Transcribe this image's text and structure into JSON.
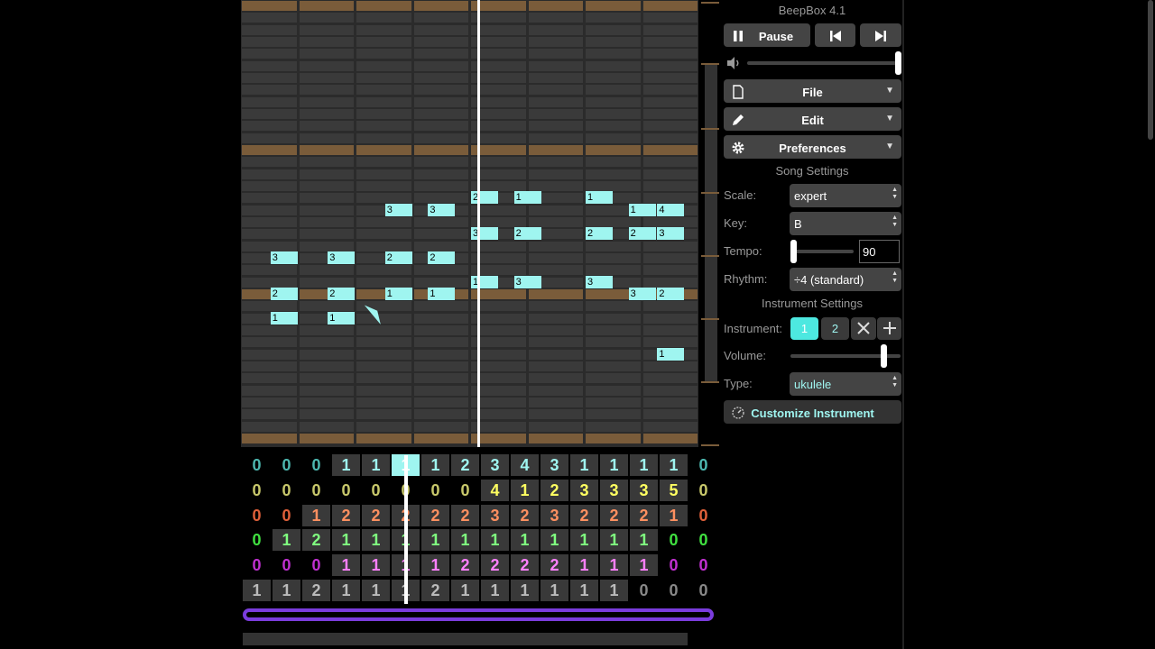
{
  "app": {
    "title": "BeepBox 4.1"
  },
  "transport": {
    "pause_label": "Pause"
  },
  "menus": {
    "file": "File",
    "edit": "Edit",
    "preferences": "Preferences"
  },
  "song_settings": {
    "heading": "Song Settings",
    "scale_label": "Scale:",
    "scale_value": "expert",
    "key_label": "Key:",
    "key_value": "B",
    "tempo_label": "Tempo:",
    "tempo_value": "90",
    "rhythm_label": "Rhythm:",
    "rhythm_value": "÷4 (standard)"
  },
  "instrument_settings": {
    "heading": "Instrument Settings",
    "instrument_label": "Instrument:",
    "instruments": [
      "1",
      "2"
    ],
    "selected_instrument": "1",
    "volume_label": "Volume:",
    "type_label": "Type:",
    "type_value": "ukulele",
    "customize_label": "Customize Instrument"
  },
  "colors": {
    "accent": "#9ff5f0",
    "octave_line": "#7a5c3a",
    "loop": "#7a3cdc",
    "channels": [
      "#4db8b0",
      "#c8c86b",
      "#e0603a",
      "#40e040",
      "#c030d0",
      "#888888"
    ],
    "channels_bright": [
      "#9ff5f0",
      "#ffff60",
      "#ff9060",
      "#80ff80",
      "#ff80ff",
      "#bbbbbb"
    ]
  },
  "pattern_grid": [
    [
      "0",
      "0",
      "0",
      "1",
      "1",
      "1",
      "1",
      "2",
      "3",
      "4",
      "3",
      "1",
      "1",
      "1",
      "1",
      "0"
    ],
    [
      "0",
      "0",
      "0",
      "0",
      "0",
      "0",
      "0",
      "0",
      "4",
      "1",
      "2",
      "3",
      "3",
      "3",
      "5",
      "0"
    ],
    [
      "0",
      "0",
      "1",
      "2",
      "2",
      "2",
      "2",
      "2",
      "3",
      "2",
      "3",
      "2",
      "2",
      "2",
      "1",
      "0"
    ],
    [
      "0",
      "1",
      "2",
      "1",
      "1",
      "1",
      "1",
      "1",
      "1",
      "1",
      "1",
      "1",
      "1",
      "1",
      "0",
      "0"
    ],
    [
      "0",
      "0",
      "0",
      "1",
      "1",
      "1",
      "1",
      "2",
      "2",
      "2",
      "2",
      "1",
      "1",
      "1",
      "0",
      "0"
    ],
    [
      "1",
      "1",
      "2",
      "1",
      "1",
      "1",
      "2",
      "1",
      "1",
      "1",
      "1",
      "1",
      "1",
      "0",
      "0",
      "0"
    ]
  ],
  "notes": [
    {
      "label": "3",
      "col": 1,
      "row": 21
    },
    {
      "label": "2",
      "col": 1,
      "row": 24
    },
    {
      "label": "1",
      "col": 1,
      "row": 26
    },
    {
      "label": "3",
      "col": 3,
      "row": 21
    },
    {
      "label": "2",
      "col": 3,
      "row": 24
    },
    {
      "label": "1",
      "col": 3,
      "row": 26
    },
    {
      "label": "3",
      "col": 5,
      "row": 17
    },
    {
      "label": "2",
      "col": 5,
      "row": 21
    },
    {
      "label": "1",
      "col": 5,
      "row": 24
    },
    {
      "label": "3",
      "col": 6.5,
      "row": 17
    },
    {
      "label": "2",
      "col": 6.5,
      "row": 21
    },
    {
      "label": "1",
      "col": 6.5,
      "row": 24
    },
    {
      "label": "2",
      "col": 8,
      "row": 16
    },
    {
      "label": "3",
      "col": 8,
      "row": 19
    },
    {
      "label": "1",
      "col": 8,
      "row": 23
    },
    {
      "label": "1",
      "col": 9.5,
      "row": 16
    },
    {
      "label": "2",
      "col": 9.5,
      "row": 19
    },
    {
      "label": "3",
      "col": 9.5,
      "row": 23
    },
    {
      "label": "1",
      "col": 12,
      "row": 16
    },
    {
      "label": "2",
      "col": 12,
      "row": 19
    },
    {
      "label": "3",
      "col": 12,
      "row": 23
    },
    {
      "label": "1",
      "col": 13.5,
      "row": 17
    },
    {
      "label": "2",
      "col": 13.5,
      "row": 19
    },
    {
      "label": "3",
      "col": 13.5,
      "row": 24
    },
    {
      "label": "4",
      "col": 14.5,
      "row": 17
    },
    {
      "label": "3",
      "col": 14.5,
      "row": 19
    },
    {
      "label": "2",
      "col": 14.5,
      "row": 24
    },
    {
      "label": "1",
      "col": 14.5,
      "row": 29
    }
  ]
}
